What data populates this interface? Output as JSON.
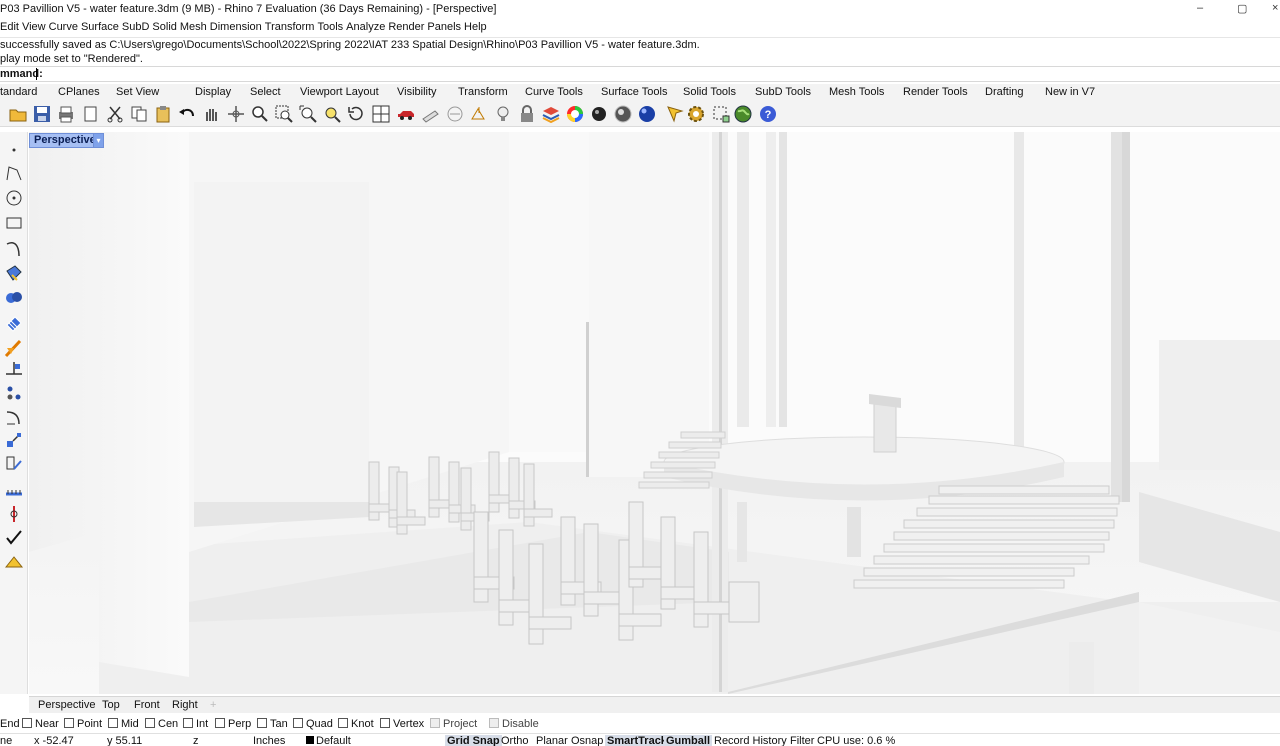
{
  "window": {
    "title": "P03 Pavillion V5 - water feature.3dm (9 MB) - Rhino 7 Evaluation (36 Days Remaining) - [Perspective]",
    "controls": [
      "–",
      "▢",
      "×"
    ]
  },
  "menu": [
    "Edit",
    "View",
    "Curve",
    "Surface",
    "SubD",
    "Solid",
    "Mesh",
    "Dimension",
    "Transform",
    "Tools",
    "Analyze",
    "Render",
    "Panels",
    "Help"
  ],
  "history": {
    "line1": "successfully saved as C:\\Users\\grego\\Documents\\School\\2022\\Spring 2022\\IAT 233 Spatial Design\\Rhino\\P03 Pavillion V5 - water feature.3dm.",
    "line2": "play mode set to \"Rendered\"."
  },
  "command": {
    "label": "mmand:"
  },
  "toolbar_tabs": [
    "tandard",
    "CPlanes",
    "Set View",
    "Display",
    "Select",
    "Viewport Layout",
    "Visibility",
    "Transform",
    "Curve Tools",
    "Surface Tools",
    "Solid Tools",
    "SubD Tools",
    "Mesh Tools",
    "Render Tools",
    "Drafting",
    "New in V7"
  ],
  "toolbar_icons": [
    "open-icon",
    "save-icon",
    "print-icon",
    "import-icon",
    "cut-icon",
    "copy-icon",
    "paste-icon",
    "undo-icon",
    "pan-icon",
    "move-view-icon",
    "zoom-icon",
    "zoom-window-icon",
    "zoom-extents-icon",
    "zoom-selected-icon",
    "rotate-view-icon",
    "four-viewports-icon",
    "car-icon",
    "hatch-icon",
    "grid-icon",
    "cplane-icon",
    "light-icon",
    "lock-icon",
    "layers-icon",
    "color-wheel-icon",
    "sphere-wire-icon",
    "sphere-shaded-icon",
    "sphere-blue-icon",
    "pick-icon",
    "settings-icon",
    "bounding-icon",
    "globe-icon",
    "help-icon"
  ],
  "viewport": {
    "label": "Perspective",
    "display_mode": "Rendered"
  },
  "viewport_tabs": [
    "Perspective",
    "Top",
    "Front",
    "Right",
    "+"
  ],
  "osnaps": [
    {
      "label": "End",
      "checked": false,
      "nobox": true
    },
    {
      "label": "Near",
      "checked": false
    },
    {
      "label": "Point",
      "checked": false
    },
    {
      "label": "Mid",
      "checked": false
    },
    {
      "label": "Cen",
      "checked": false
    },
    {
      "label": "Int",
      "checked": false
    },
    {
      "label": "Perp",
      "checked": false
    },
    {
      "label": "Tan",
      "checked": false
    },
    {
      "label": "Quad",
      "checked": false
    },
    {
      "label": "Knot",
      "checked": false
    },
    {
      "label": "Vertex",
      "checked": false
    },
    {
      "label": "Project",
      "checked": false,
      "disabled": true
    },
    {
      "label": "Disable",
      "checked": false,
      "disabled": true
    }
  ],
  "status": {
    "plane": "ne",
    "x": "x -52.47",
    "y": "y 55.11",
    "z": "z",
    "units": "Inches",
    "layer": "Default",
    "grid_snap": "Grid Snap",
    "ortho": "Ortho",
    "planar": "Planar",
    "osnap": "Osnap",
    "smarttrack": "SmartTrack",
    "gumball": "Gumball",
    "record_history": "Record History",
    "filter": "Filter",
    "cpu": "CPU use: 0.6 %"
  },
  "colors": {
    "viewport_label_bg": "#a6bff3",
    "toolbar_bg": "#f3f3f3",
    "accent": "#6f8fd8"
  }
}
